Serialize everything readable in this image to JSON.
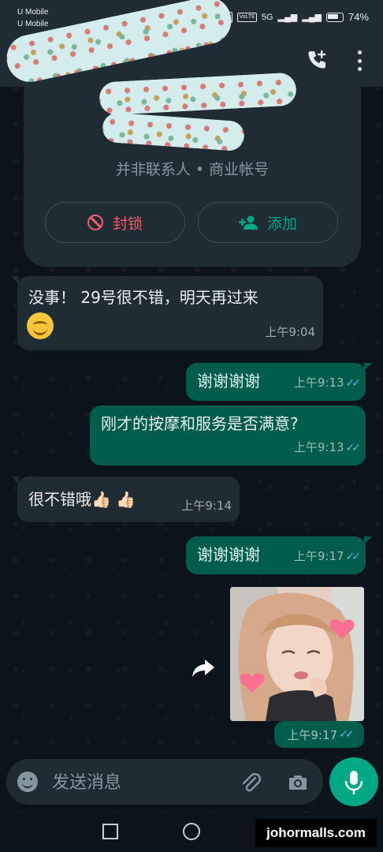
{
  "status_bar": {
    "carrier_1": "U Mobile",
    "carrier_2": "U Mobile",
    "network": "5G",
    "battery": "74%"
  },
  "contact": {
    "subtitle": "并非联系人 • 商业帐号",
    "block_label": "封锁",
    "add_label": "添加"
  },
  "messages": [
    {
      "direction": "in",
      "text": "没事！ 29号很不错，明天再过来",
      "time": "上午9:04"
    },
    {
      "direction": "out",
      "text": "谢谢谢谢",
      "time": "上午9:13",
      "ticks": "✓✓"
    },
    {
      "direction": "out",
      "text": "刚才的按摩和服务是否满意?",
      "time": "上午9:13",
      "ticks": "✓✓"
    },
    {
      "direction": "in",
      "text": "很不错哦👍🏻 👍🏻",
      "time": "上午9:14"
    },
    {
      "direction": "out",
      "text": "谢谢谢谢",
      "time": "上午9:17",
      "ticks": "✓✓"
    },
    {
      "direction": "out",
      "type": "photo",
      "time": "上午9:17",
      "ticks": "✓✓"
    }
  ],
  "composer": {
    "placeholder": "发送消息"
  },
  "watermark": "johormalls.com",
  "colors": {
    "incoming_bubble": "#1f2c34",
    "outgoing_bubble": "#005c4b",
    "accent": "#00a884",
    "block_red": "#f15c6d",
    "read_ticks": "#53bdeb"
  }
}
